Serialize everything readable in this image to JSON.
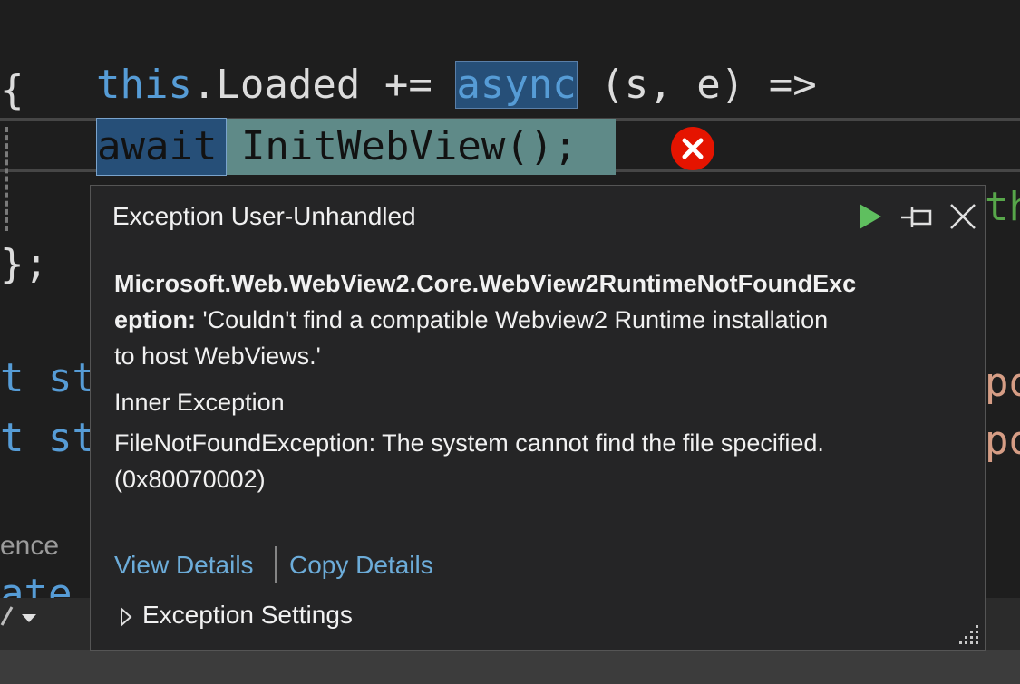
{
  "editor": {
    "line1": {
      "kw_this": "this",
      "mid": ".Loaded += ",
      "kw_async": "async",
      "rest": " (s, e) =>"
    },
    "line2": "{",
    "line3": {
      "kw_await": "await",
      "rest": " InitWebView();"
    },
    "line5": "};",
    "line6_partial": "t st",
    "line7_partial": "t st",
    "right_partial_1": "th",
    "right_partial_2": "ро",
    "right_partial_3": "ро",
    "ref_text": "ence",
    "line8_partial": "ate"
  },
  "popup": {
    "title": "Exception User-Unhandled",
    "exception_type_line1": "Microsoft.Web.WebView2.Core.WebView2RuntimeNotFoundExc",
    "exception_type_line2": "eption:",
    "exception_message_line2": " 'Couldn't find a compatible Webview2 Runtime installation",
    "exception_message_line3": "to host WebViews.'",
    "inner_exception_label": "Inner Exception",
    "inner_exception_line1": "FileNotFoundException: The system cannot find the file specified.",
    "inner_exception_line2": "(0x80070002)",
    "view_details_label": "View Details",
    "copy_details_label": "Copy Details",
    "exception_settings_label": "Exception Settings"
  },
  "colors": {
    "editor_bg": "#1e1e1e",
    "popup_bg": "#252526",
    "link": "#6cacd9",
    "keyword": "#569cd6",
    "continue_green": "#5fbf5f",
    "error_red": "#e51400"
  },
  "icons": [
    "error-icon",
    "continue-icon",
    "pin-icon",
    "close-icon",
    "expand-chevron-icon",
    "resize-grip-icon",
    "pencil-icon",
    "chevron-down-icon"
  ]
}
